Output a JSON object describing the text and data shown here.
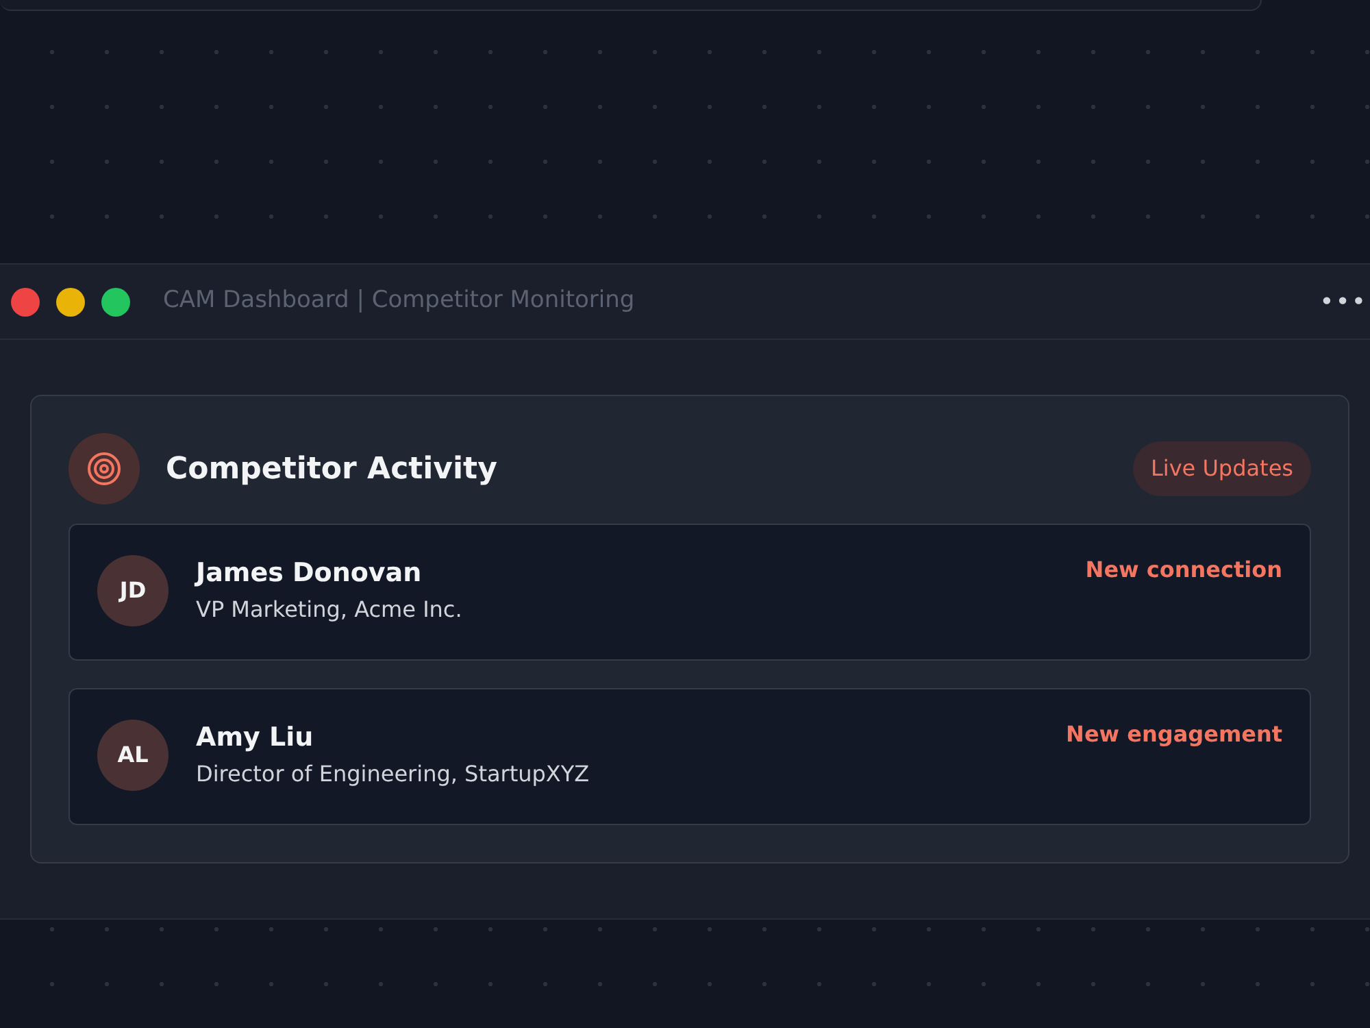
{
  "window": {
    "title": "CAM Dashboard | Competitor Monitoring",
    "menu": "•••"
  },
  "panel": {
    "title": "Competitor Activity",
    "badge": "Live Updates",
    "items": [
      {
        "initials": "JD",
        "name": "James Donovan",
        "role": "VP Marketing, Acme Inc.",
        "event": "New connection"
      },
      {
        "initials": "AL",
        "name": "Amy Liu",
        "role": "Director of Engineering, StartupXYZ",
        "event": "New engagement"
      }
    ]
  }
}
